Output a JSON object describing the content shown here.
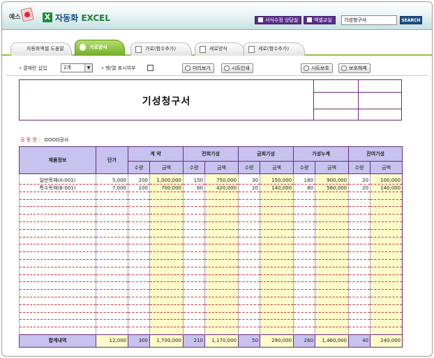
{
  "header": {
    "logo_text": "예스",
    "brand": "자동화",
    "brand_sub": "EXCEL",
    "buttons": [
      "서식수정 상담실",
      "엑셀교실"
    ],
    "search_value": "기성청구서",
    "search_button": "SEARCH"
  },
  "tabs": [
    {
      "label": "자동화엑셀 도움말"
    },
    {
      "label": "가로양식"
    },
    {
      "label": "가로(함수추가)"
    },
    {
      "label": "세로양식"
    },
    {
      "label": "세로(함수추가)"
    }
  ],
  "toolbar": {
    "payment_label": "결재란 삽입",
    "payment_value": "2개",
    "rowcol_label": "행/열 표시여부",
    "preview_button": "미리보기",
    "print_button": "시트인쇄",
    "protect_button": "시트보호",
    "unprotect_button": "보호해제"
  },
  "document": {
    "title": "기성청구서",
    "project_label": "공  종  명 :",
    "project_value": "OOOO공사"
  },
  "table": {
    "headers": {
      "product": "제품정보",
      "unit_price": "단가",
      "groups": [
        "계  약",
        "전회기성",
        "금회기성",
        "기성누계",
        "잔여기성"
      ],
      "qty": "수량",
      "amount": "금액"
    },
    "rows": [
      {
        "name": "일반목재(A-001)",
        "price": "5,000",
        "cells": [
          "200",
          "1,000,000",
          "150",
          "750,000",
          "30",
          "150,000",
          "180",
          "900,000",
          "20",
          "100,000"
        ]
      },
      {
        "name": "특수목재(B-001)",
        "price": "7,000",
        "cells": [
          "100",
          "700,000",
          "60",
          "420,000",
          "20",
          "140,000",
          "80",
          "560,000",
          "20",
          "140,000"
        ]
      }
    ],
    "empty_rows": 19,
    "totals": {
      "label": "합계내역",
      "price": "12,000",
      "cells": [
        "300",
        "1,700,000",
        "210",
        "1,170,000",
        "50",
        "290,000",
        "260",
        "1,460,000",
        "40",
        "240,000"
      ]
    }
  },
  "colors": {
    "header_band": "#c7c2ee",
    "amount_fill": "#fdfbc8",
    "border": "#6b2b7d",
    "tab_active": "#6fae25"
  }
}
